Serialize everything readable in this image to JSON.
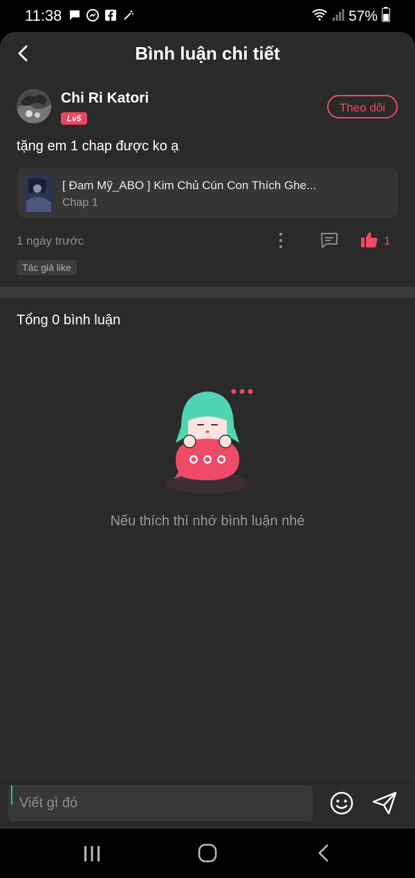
{
  "status_bar": {
    "time": "11:38",
    "battery": "57%",
    "icons_left": [
      "message-icon",
      "messenger-icon",
      "facebook-icon",
      "magic-wand-icon"
    ],
    "icons_right": [
      "wifi-icon",
      "signal-icon",
      "battery-icon"
    ]
  },
  "header": {
    "title": "Bình luận chi tiết"
  },
  "comment": {
    "username": "Chi Ri Katori",
    "level": "Lv5",
    "follow_label": "Theo dõi",
    "text": "tặng em 1 chap được ko ạ",
    "chapter": {
      "title": "[ Đam Mỹ_ABO ] Kim Chủ Cún Con Thích Ghe...",
      "subtitle": "Chap 1"
    },
    "timestamp": "1 ngày trước",
    "like_count": "1",
    "author_tag": "Tác giả like"
  },
  "comments_section": {
    "total": "Tổng 0 bình luận",
    "empty_message": "Nếu thích thì nhớ bình luận nhé"
  },
  "input": {
    "placeholder": "Viết gì đó"
  },
  "colors": {
    "accent": "#ef4a66",
    "background": "#2a2a2a",
    "mascot_hair": "#4fd6b0"
  }
}
